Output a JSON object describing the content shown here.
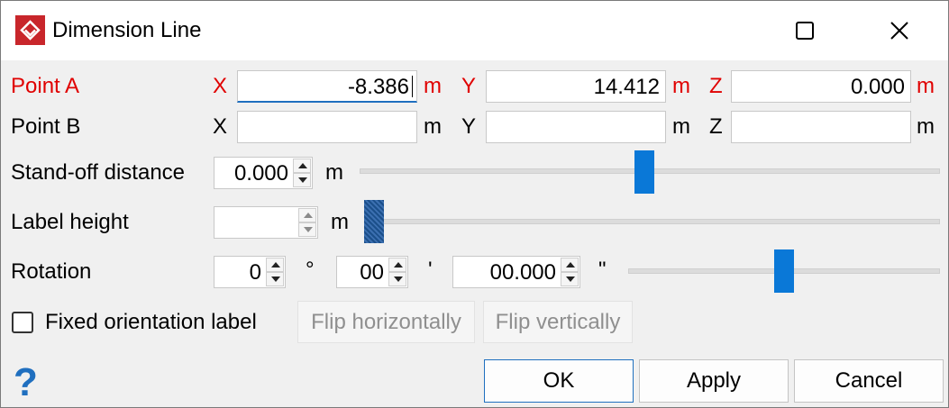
{
  "window": {
    "title": "Dimension Line"
  },
  "point_a": {
    "label": "Point A",
    "x_label": "X",
    "x_value": "-8.386",
    "x_unit": "m",
    "y_label": "Y",
    "y_value": "14.412",
    "y_unit": "m",
    "z_label": "Z",
    "z_value": "0.000",
    "z_unit": "m",
    "highlight_color": "#e00000"
  },
  "point_b": {
    "label": "Point B",
    "x_label": "X",
    "x_value": "",
    "x_unit": "m",
    "y_label": "Y",
    "y_value": "",
    "y_unit": "m",
    "z_label": "Z",
    "z_value": "",
    "z_unit": "m"
  },
  "standoff": {
    "label": "Stand-off distance",
    "value": "0.000",
    "unit": "m",
    "slider_fraction": 0.49
  },
  "label_height": {
    "label": "Label height",
    "value": "",
    "unit": "m",
    "slider_fraction": 0.0
  },
  "rotation": {
    "label": "Rotation",
    "degrees": "0",
    "degree_symbol": "°",
    "minutes": "00",
    "minute_symbol": "'",
    "seconds": "00.000",
    "second_symbol": "\"",
    "slider_fraction": 0.5
  },
  "options": {
    "fixed_orientation_label": "Fixed orientation label",
    "fixed_orientation_checked": false,
    "flip_horizontally": "Flip horizontally",
    "flip_vertically": "Flip vertically"
  },
  "buttons": {
    "ok": "OK",
    "apply": "Apply",
    "cancel": "Cancel",
    "help": "?"
  },
  "icons": {
    "app": "dimension-line-icon",
    "maximize": "maximize-icon",
    "close": "close-icon",
    "help": "help-icon"
  },
  "colors": {
    "accent": "#0a78d7",
    "app_icon_bg": "#c8262b",
    "help_blue": "#1f6fbf"
  }
}
